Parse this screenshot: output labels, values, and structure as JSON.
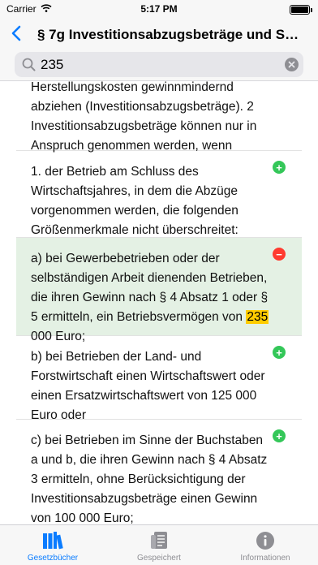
{
  "status": {
    "carrier": "Carrier",
    "time": "5:17 PM",
    "battery_level": 1.0
  },
  "nav": {
    "back_icon": "chevron-left-icon",
    "title": "§ 7g Investitionsabzugsbeträge und Sond..."
  },
  "search": {
    "value": "235",
    "icon": "search-icon",
    "clear_icon": "clear-icon"
  },
  "colors": {
    "accent": "#0a7cff",
    "highlight_row": "#e4f1e4",
    "match": "#ffcc00",
    "add": "#34c759",
    "remove": "#ff3b30"
  },
  "paragraphs": [
    {
      "text": "Herstellungskosten gewinnmindernd abziehen (Investitionsabzugsbeträge). 2 Investitionsabzugsbeträge können nur in Anspruch genommen werden, wenn",
      "toggle": "none"
    },
    {
      "text": "1. der Betrieb am Schluss des Wirtschaftsjahres, in dem die Abzüge vorgenommen werden, die folgenden Größenmerkmale nicht überschreitet:",
      "toggle": "add"
    },
    {
      "text_before": "a) bei Gewerbebetrieben oder der selbständigen Arbeit dienenden Betrieben, die ihren Gewinn nach § 4 Absatz 1 oder § 5 ermitteln, ein Betriebsvermögen von",
      "match": "235",
      "text_after": "000 Euro;",
      "toggle": "remove",
      "highlighted": true
    },
    {
      "text": "b) bei Betrieben der Land- und Forstwirtschaft einen Wirtschaftswert oder einen Ersatzwirtschaftswert von 125 000 Euro oder",
      "toggle": "add"
    },
    {
      "text": "c) bei Betrieben im Sinne der Buchstaben a und b, die ihren Gewinn nach § 4 Absatz 3 ermitteln, ohne Berücksichtigung der Investitionsabzugsbeträge einen Gewinn von 100 000 Euro;",
      "toggle": "add"
    }
  ],
  "tabs": [
    {
      "label": "Gesetzbücher",
      "icon": "books-icon",
      "active": true
    },
    {
      "label": "Gespeichert",
      "icon": "saved-document-icon",
      "active": false
    },
    {
      "label": "Informationen",
      "icon": "info-icon",
      "active": false
    }
  ]
}
